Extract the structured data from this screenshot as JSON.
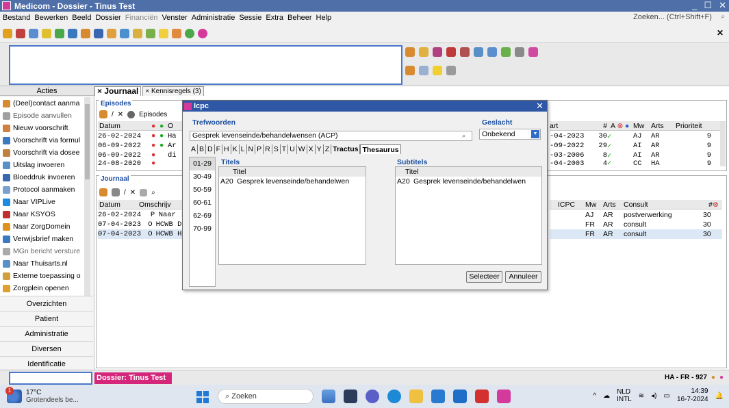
{
  "window": {
    "title": "Medicom - Dossier - Tinus Test",
    "controls": [
      "_",
      "☐",
      "✕"
    ]
  },
  "menu": {
    "items": [
      "Bestand",
      "Bewerken",
      "Beeld",
      "Dossier",
      "Financiën",
      "Venster",
      "Administratie",
      "Sessie",
      "Extra",
      "Beheer",
      "Help"
    ],
    "search_placeholder": "Zoeken... (Ctrl+Shift+F)"
  },
  "sidebar": {
    "header": "Acties",
    "items": [
      "(Deel)contact aanma",
      "Episode aanvullen",
      "Nieuw voorschrift",
      "Voorschrift via formul",
      "Voorschrift via dosee",
      "Uitslag invoeren",
      "Bloeddruk invoeren",
      "Protocol aanmaken",
      "Naar VIPLive",
      "Naar KSYOS",
      "Naar ZorgDomein",
      "Verwijsbrief maken",
      "MGn bericht versture",
      "Naar Thuisarts.nl",
      "Externe toepassing o",
      "Zorgplein openen"
    ],
    "sections": [
      "Overzichten",
      "Patient",
      "Administratie",
      "Diversen",
      "Identificatie"
    ]
  },
  "tabs": [
    "Journaal",
    "Kennisregels (3)"
  ],
  "episodes": {
    "title": "Episodes",
    "toolbar_label": "Episodes",
    "header_left": [
      "Datum",
      "O"
    ],
    "rows_left": [
      {
        "date": "26-02-2024",
        "text": "Ha"
      },
      {
        "date": "06-09-2022",
        "text": "Ar"
      },
      {
        "date": "06-09-2022",
        "text": "di"
      },
      {
        "date": "24-08-2020",
        "text": ""
      }
    ],
    "header_right": [
      "art",
      "#",
      "A",
      "Mw",
      "Arts",
      "Prioriteit"
    ],
    "rows_right": [
      {
        "start": "-04-2023",
        "n": "30",
        "mw": "AJ",
        "arts": "AR",
        "prio": "9"
      },
      {
        "start": "-09-2022",
        "n": "29",
        "mw": "AI",
        "arts": "AR",
        "prio": "9"
      },
      {
        "start": "-03-2006",
        "n": "8",
        "mw": "AI",
        "arts": "AR",
        "prio": "9"
      },
      {
        "start": "-04-2003",
        "n": "4",
        "mw": "CC",
        "arts": "HA",
        "prio": "9"
      }
    ]
  },
  "journaal": {
    "title": "Journaal",
    "header_left": [
      "Datum",
      "Omschrijv"
    ],
    "rows_left": [
      {
        "date": "26-02-2024",
        "type": "P",
        "text": "Naar :"
      },
      {
        "date": "07-04-2023",
        "type": "O",
        "text": "HCWB DI"
      },
      {
        "date": "07-04-2023",
        "type": "O",
        "text": "HCWB Ha"
      }
    ],
    "header_right": [
      "ICPC",
      "Mw",
      "Arts",
      "Consult",
      "#"
    ],
    "rows_right": [
      {
        "mw": "AJ",
        "arts": "AR",
        "consult": "postverwerking",
        "n": "30"
      },
      {
        "mw": "FR",
        "arts": "AR",
        "consult": "consult",
        "n": "30"
      },
      {
        "mw": "FR",
        "arts": "AR",
        "consult": "consult",
        "n": "30"
      }
    ]
  },
  "dialog": {
    "title": "Icpc",
    "trefwoorden_label": "Trefwoorden",
    "trefwoorden_value": "Gesprek levenseinde/behandelwensen (ACP)",
    "geslacht_label": "Geslacht",
    "geslacht_value": "Onbekend",
    "letters": [
      "A",
      "B",
      "D",
      "F",
      "H",
      "K",
      "L",
      "N",
      "P",
      "R",
      "S",
      "T",
      "U",
      "W",
      "X",
      "Y",
      "Z",
      "Tractus",
      "Thesaurus"
    ],
    "ranges": [
      "01-29",
      "30-49",
      "50-59",
      "60-61",
      "62-69",
      "70-99"
    ],
    "titels_label": "Titels",
    "subtitels_label": "Subtitels",
    "col_titel": "Titel",
    "titel_row": {
      "code": "A20",
      "text": "Gesprek levenseinde/behandelwen"
    },
    "subtitel_row": {
      "code": "A20",
      "text": "Gesprek levenseinde/behandelwen"
    },
    "select_label": "Selecteer",
    "cancel_label": "Annuleer"
  },
  "status": {
    "tag": "Dossier: Tinus Test",
    "right": "HA - FR - 927"
  },
  "taskbar": {
    "badge": "1",
    "temp": "17°C",
    "weather": "Grotendeels be...",
    "search": "Zoeken",
    "lang1": "NLD",
    "lang2": "INTL",
    "time": "14:39",
    "date": "16-7-2024"
  }
}
